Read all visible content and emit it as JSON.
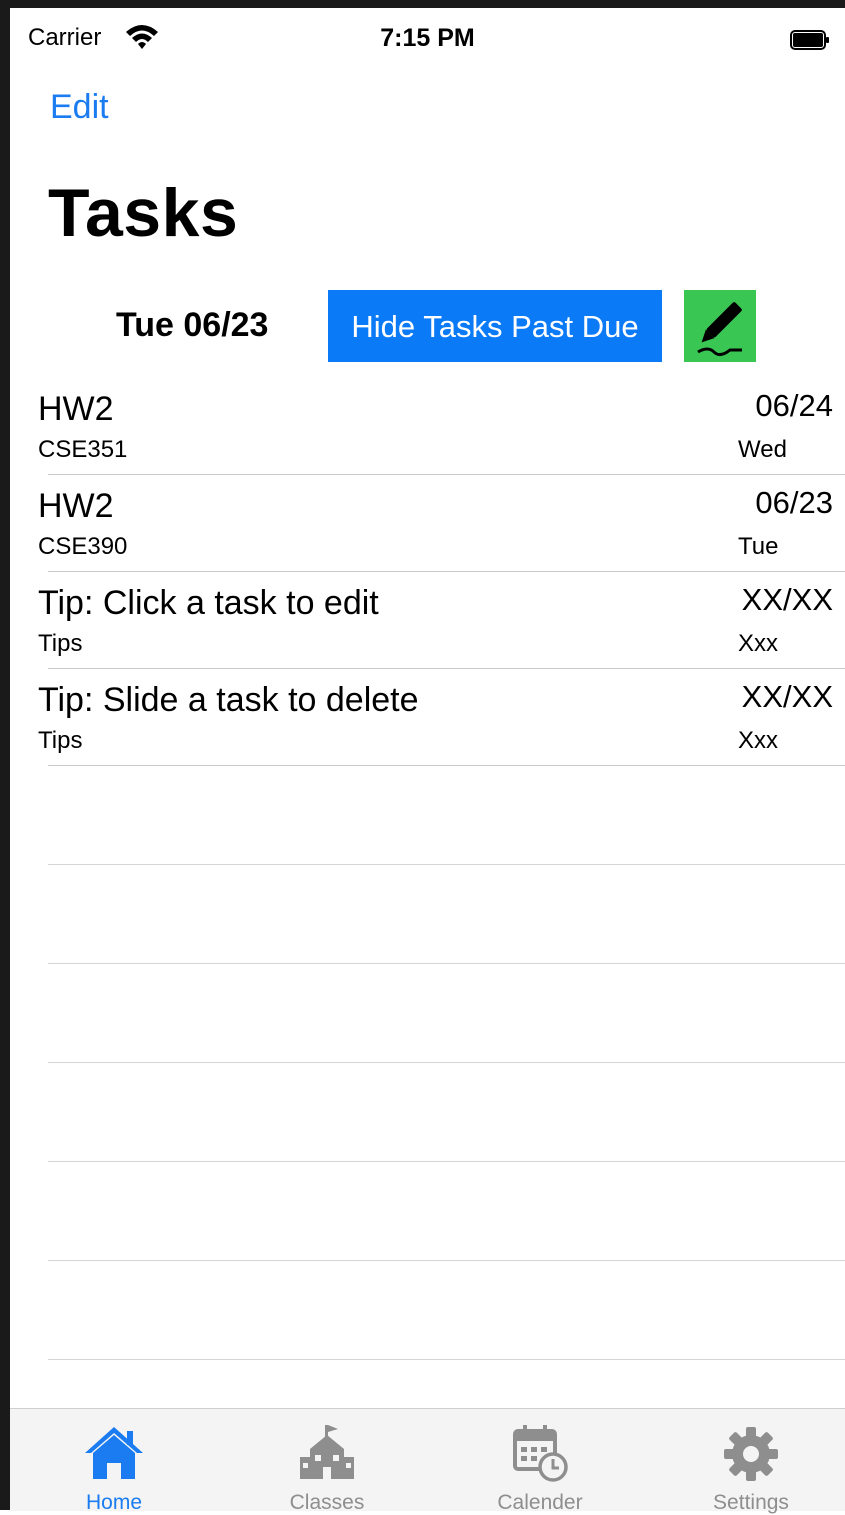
{
  "status": {
    "carrier": "Carrier",
    "time": "7:15 PM"
  },
  "nav": {
    "edit_label": "Edit",
    "title": "Tasks"
  },
  "controls": {
    "date": "Tue 06/23",
    "hide_label": "Hide Tasks Past Due"
  },
  "tasks": [
    {
      "title": "HW2",
      "course": "CSE351",
      "date": "06/24",
      "day": "Wed"
    },
    {
      "title": "HW2",
      "course": "CSE390",
      "date": "06/23",
      "day": "Tue"
    },
    {
      "title": "Tip: Click a task to edit",
      "course": "Tips",
      "date": "XX/XX",
      "day": "Xxx"
    },
    {
      "title": "Tip: Slide a task to delete",
      "course": "Tips",
      "date": "XX/XX",
      "day": "Xxx"
    }
  ],
  "tabs": [
    {
      "label": "Home",
      "icon": "home-icon"
    },
    {
      "label": "Classes",
      "icon": "school-icon"
    },
    {
      "label": "Calender",
      "icon": "calendar-icon"
    },
    {
      "label": "Settings",
      "icon": "gear-icon"
    }
  ],
  "colors": {
    "accent": "#1a7cf0",
    "hide_button": "#0a7af7",
    "pencil_button": "#39c653"
  }
}
